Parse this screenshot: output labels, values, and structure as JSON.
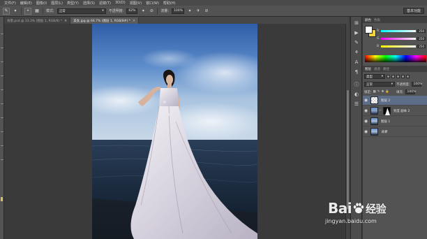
{
  "menu": {
    "items": [
      "文件(F)",
      "编辑(E)",
      "图像(I)",
      "图层(L)",
      "类型(Y)",
      "选择(S)",
      "滤镜(T)",
      "3D(D)",
      "视图(V)",
      "窗口(W)",
      "帮助(H)"
    ]
  },
  "options": {
    "mode_label": "模式:",
    "mode_value": "正常",
    "opacity_label": "不透明度:",
    "opacity_value": "62%",
    "flow_label": "流量:",
    "flow_value": "100%",
    "workspace": "基本功能"
  },
  "tabs": [
    {
      "label": "背景.psd @ 33.3% (图层 1, RGB/8) *",
      "active": false
    },
    {
      "label": "美女.jpg @ 66.7% (图层 1, RGB/8#) *",
      "active": true
    }
  ],
  "color_panel": {
    "tabs": [
      "颜色",
      "色板"
    ],
    "foreground": "#ffffff",
    "background": "#f3d23f",
    "channels": [
      {
        "label": "R",
        "value": "250"
      },
      {
        "label": "G",
        "value": "250"
      },
      {
        "label": "B",
        "value": "250"
      }
    ]
  },
  "layers_panel": {
    "tabs": [
      "图层",
      "通道",
      "路径"
    ],
    "filter_label": "类型",
    "blend_mode": "正常",
    "opacity_label": "不透明度:",
    "opacity_value": "100%",
    "lock_label": "锁定:",
    "fill_label": "填充:",
    "fill_value": "100%",
    "layers": [
      {
        "name": "图层 2",
        "selected": true,
        "has_mask": false,
        "italic": false
      },
      {
        "name": "亮度 副本 2",
        "selected": false,
        "has_mask": true,
        "italic": false
      },
      {
        "name": "图层 1",
        "selected": false,
        "has_mask": false,
        "italic": false
      },
      {
        "name": "背景",
        "selected": false,
        "has_mask": false,
        "italic": true
      }
    ]
  },
  "watermark": {
    "logo_text_a": "Bai",
    "logo_text_b": "经验",
    "url": "jingyan.baidu.com"
  }
}
